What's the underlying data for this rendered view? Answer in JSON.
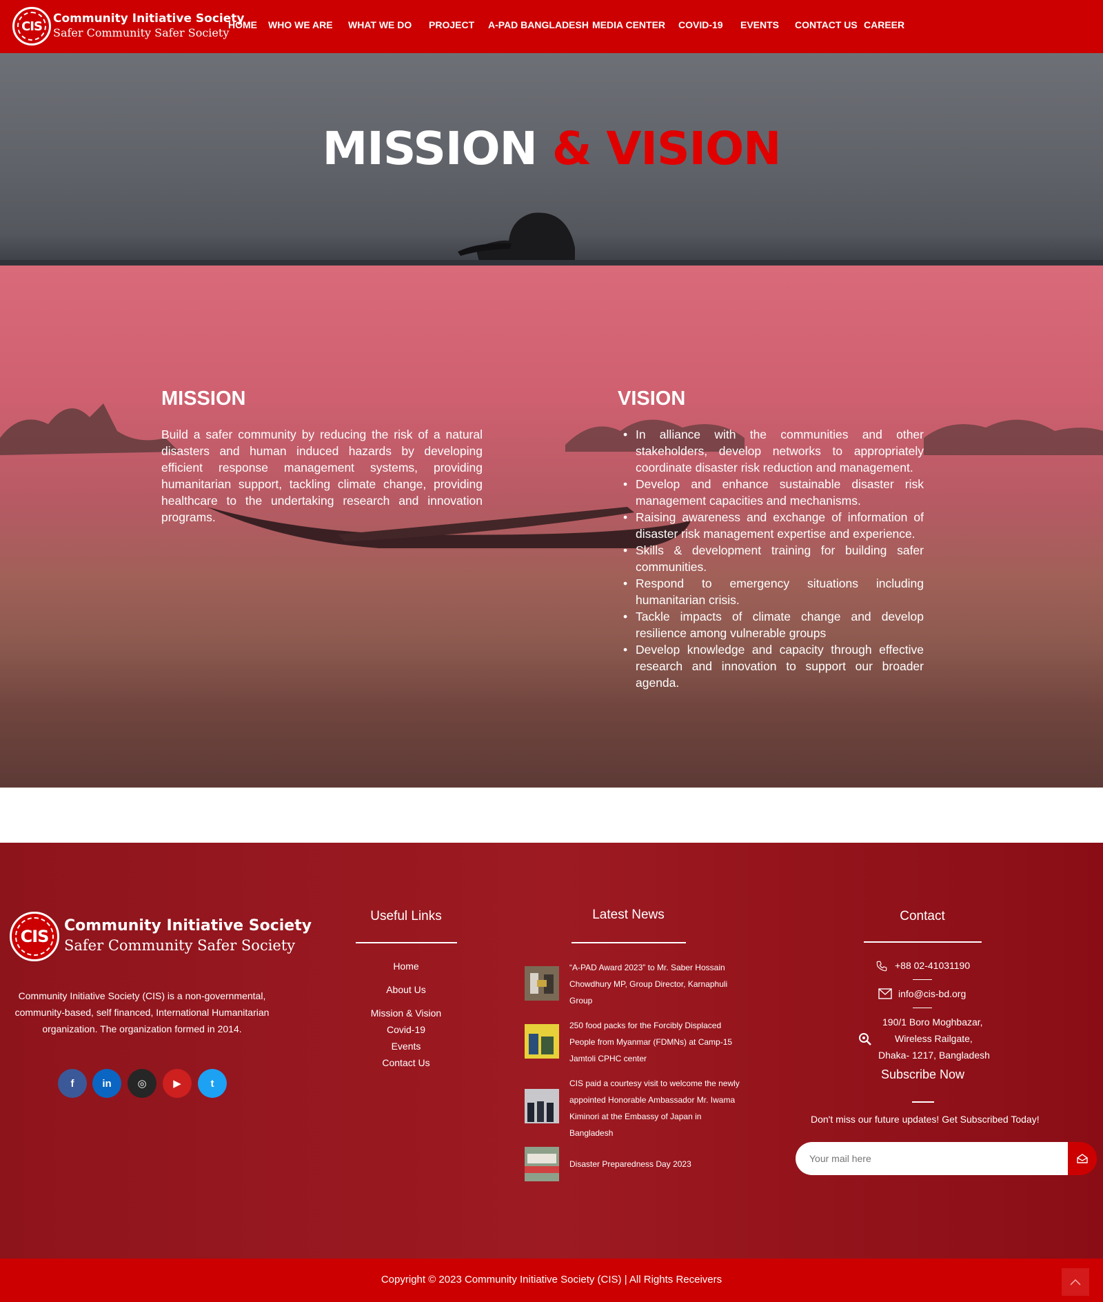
{
  "brand": {
    "logo_text": "CIS",
    "name": "Community Initiative Society",
    "tagline": "Safer Community Safer Society"
  },
  "nav": {
    "items": [
      {
        "label": "HOME"
      },
      {
        "label": "WHO WE ARE"
      },
      {
        "label": "WHAT WE DO"
      },
      {
        "label": "PROJECT"
      },
      {
        "label": "A-PAD BANGLADESH"
      },
      {
        "label": "MEDIA CENTER"
      },
      {
        "label": "COVID-19"
      },
      {
        "label": "EVENTS"
      },
      {
        "label": "CONTACT US"
      },
      {
        "label": "CAREER"
      }
    ]
  },
  "hero": {
    "title_part1": "MISSION",
    "title_part2": "& VISION"
  },
  "mission": {
    "heading": "MISSION",
    "text": "Build a safer community by reducing the risk of a natural disasters and human induced hazards by developing efficient response management systems, providing humanitarian support, tackling climate change, providing healthcare to the undertaking research and innovation programs."
  },
  "vision": {
    "heading": "VISION",
    "items": [
      "In alliance with the communities and other stakeholders, develop networks to appropriately coordinate disaster risk reduction and management.",
      "Develop and enhance sustainable disaster risk management capacities and mechanisms.",
      "Raising awareness and exchange of information of disaster risk management expertise and experience.",
      "Skills & development training for building safer communities.",
      "Respond to emergency situations including humanitarian crisis.",
      "Tackle impacts of climate change and develop resilience among vulnerable groups",
      "Develop knowledge and capacity through effective research and innovation to support our broader agenda."
    ]
  },
  "footer": {
    "about": "Community Initiative Society (CIS) is a non-governmental, community-based, self financed, International Humanitarian organization. The organization formed in 2014.",
    "social": [
      {
        "icon": "facebook-icon",
        "glyph": "f",
        "color": "#3b5998"
      },
      {
        "icon": "linkedin-icon",
        "glyph": "in",
        "color": "#0a66c2"
      },
      {
        "icon": "instagram-icon",
        "glyph": "◎",
        "color": "#262626"
      },
      {
        "icon": "youtube-icon",
        "glyph": "▶",
        "color": "#cd201f"
      },
      {
        "icon": "twitter-icon",
        "glyph": "t",
        "color": "#1da1f2"
      }
    ],
    "useful_links": {
      "heading": "Useful Links",
      "items": [
        "Home",
        "About Us",
        "Mission & Vision",
        "Covid-19",
        "Events",
        "Contact Us"
      ]
    },
    "latest_news": {
      "heading": "Latest News",
      "items": [
        "“A-PAD Award 2023” to Mr. Saber Hossain Chowdhury MP, Group Director, Karnaphuli Group",
        "250 food packs for the Forcibly Displaced People from Myanmar (FDMNs) at Camp-15 Jamtoli CPHC center",
        "CIS paid a courtesy visit to welcome the newly appointed Honorable Ambassador Mr. Iwama Kiminori at the Embassy of Japan in Bangladesh",
        "Disaster Preparedness Day 2023"
      ]
    },
    "contact": {
      "heading": "Contact",
      "phone": "+88 02-41031190",
      "email": "info@cis-bd.org",
      "address_line1": "190/1 Boro Moghbazar,",
      "address_line2": "Wireless Railgate,",
      "address_line3": "Dhaka- 1217, Bangladesh"
    },
    "subscribe": {
      "heading": "Subscribe Now",
      "text": "Don't miss our future updates! Get Subscribed Today!",
      "placeholder": "Your mail here"
    }
  },
  "copyright": "Copyright © 2023 Community Initiative Society (CIS) | All Rights Receivers"
}
